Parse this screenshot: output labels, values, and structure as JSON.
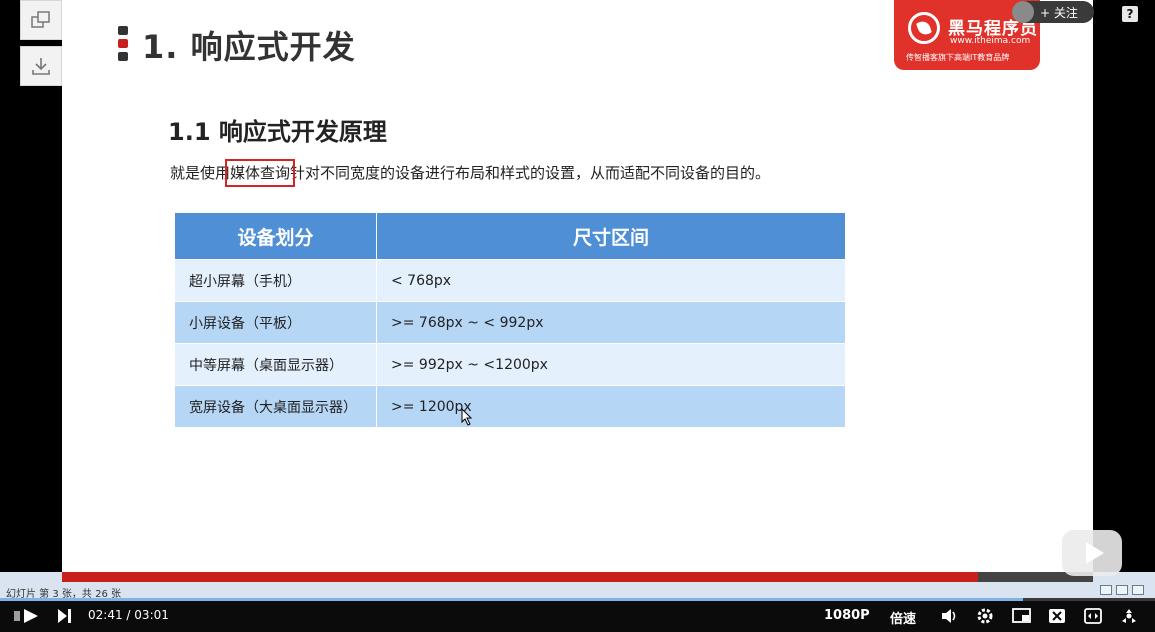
{
  "slide": {
    "title": "1. 响应式开发",
    "subtitle": "1.1 响应式开发原理",
    "desc_before": "就是使用",
    "desc_highlight": "媒体查询",
    "desc_after": "针对不同宽度的设备进行布局和样式的设置，从而适配不同设备的目的。",
    "table": {
      "headers": [
        "设备划分",
        "尺寸区间"
      ],
      "rows": [
        [
          "超小屏幕（手机）",
          "< 768px"
        ],
        [
          "小屏设备（平板）",
          ">= 768px  ~  < 992px"
        ],
        [
          "中等屏幕（桌面显示器）",
          ">= 992px  ~  <1200px"
        ],
        [
          "宽屏设备（大桌面显示器）",
          ">= 1200px"
        ]
      ]
    }
  },
  "logo": {
    "brand": "黑马程序员",
    "url": "www.itheima.com",
    "tagline": "传智播客旗下高端IT教育品牌"
  },
  "ppt": {
    "status": "幻灯片 第 3 张，共 26 张"
  },
  "header": {
    "follow_label": "+ 关注",
    "help_label": "?"
  },
  "player": {
    "current_time": "02:41",
    "separator": "/",
    "total_time": "03:01",
    "quality": "1080P",
    "speed": "倍速",
    "progress": 0.886
  },
  "colors": {
    "table_header": "#4f8fd6",
    "row_light": "#e4f0fc",
    "row_dark": "#b6d6f5",
    "brand_red": "#e0312a",
    "highlight_border": "#d32525"
  }
}
